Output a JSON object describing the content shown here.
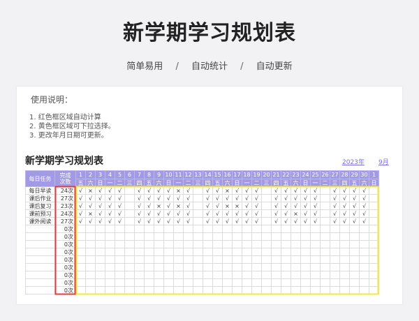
{
  "header": {
    "title": "新学期学习规划表",
    "subtitle": [
      "简单易用",
      "自动统计",
      "自动更新"
    ],
    "separator": "/"
  },
  "instructions": {
    "title": "使用说明：",
    "items": [
      "1. 红色框区域自动计算",
      "2. 黄色框区域可下拉选择。",
      "3. 更改年月日期可更新。"
    ]
  },
  "sheet": {
    "title": "新学期学习规划表",
    "year": "2023年",
    "month": "9月",
    "task_header": "每日任务",
    "count_header_line1": "完成",
    "count_header_line2": "次数",
    "days": [
      "1",
      "2",
      "3",
      "4",
      "5",
      "6",
      "7",
      "8",
      "9",
      "10",
      "11",
      "12",
      "13",
      "14",
      "15",
      "16",
      "17",
      "18",
      "19",
      "20",
      "21",
      "22",
      "23",
      "24",
      "25",
      "26",
      "27",
      "28",
      "29",
      "30",
      "1"
    ],
    "weekdays": [
      "五",
      "六",
      "日",
      "一",
      "二",
      "三",
      "四",
      "五",
      "六",
      "日",
      "一",
      "二",
      "三",
      "四",
      "五",
      "六",
      "日",
      "一",
      "二",
      "三",
      "四",
      "五",
      "六",
      "日",
      "一",
      "二",
      "三",
      "四",
      "五",
      "六",
      "日"
    ],
    "rows": [
      {
        "task": "每日早读",
        "count": "24次",
        "marks": "√×√√√ √√√√×√ √√×√√√ √√√√√ √√√√"
      },
      {
        "task": "课后作业",
        "count": "27次",
        "marks": "√√√√√ √√√√√√ √√√√√√ √√√√√ √√√√"
      },
      {
        "task": "课后复习",
        "count": "23次",
        "marks": "√√√√√ √√×√×√ √√××√√ √√√√√ √√√√"
      },
      {
        "task": "课前预习",
        "count": "24次",
        "marks": "√×√√√ √√√√√√ √√√√√√ √√×√√ √√√√"
      },
      {
        "task": "课外阅读",
        "count": "27次",
        "marks": "√√√√√ √√√√√√ √√√√√√ √√√√√ √√√√"
      },
      {
        "task": "",
        "count": "0次",
        "marks": ""
      },
      {
        "task": "",
        "count": "0次",
        "marks": ""
      },
      {
        "task": "",
        "count": "0次",
        "marks": ""
      },
      {
        "task": "",
        "count": "0次",
        "marks": ""
      },
      {
        "task": "",
        "count": "0次",
        "marks": ""
      },
      {
        "task": "",
        "count": "0次",
        "marks": ""
      },
      {
        "task": "",
        "count": "0次",
        "marks": ""
      },
      {
        "task": "",
        "count": "0次",
        "marks": ""
      },
      {
        "task": "",
        "count": "0次",
        "marks": ""
      }
    ]
  },
  "colors": {
    "header_bg": "#a39ae6",
    "red_frame": "#e23b3b",
    "yellow_frame": "#f2ea3a",
    "link": "#7a6fd8"
  }
}
